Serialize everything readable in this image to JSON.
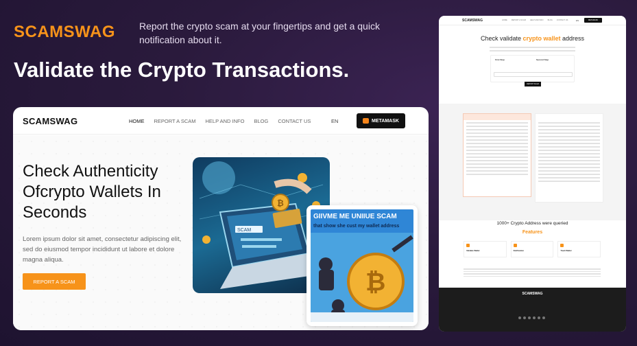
{
  "header": {
    "brand": "SCAMSWAG",
    "tagline": "Report the crypto scam at your fingertips and get a quick notification about it.",
    "headline": "Validate the Crypto Transactions."
  },
  "site": {
    "logo": "SCAMSWAG",
    "nav": [
      "HOME",
      "REPORT A SCAM",
      "HELP AND INFO",
      "BLOG",
      "CONTACT US"
    ],
    "language": "EN",
    "wallet_button": "METAMASK",
    "hero": {
      "title": "Check Authenticity Ofcrypto Wallets In Seconds",
      "body": "Lorem ipsum dolor sit amet, consectetur adipiscing elit, sed do eiusmod tempor incididunt ut labore et dolore magna aliqua.",
      "cta": "REPORT A SCAM"
    },
    "image_text": {
      "laptop_label": "SCAM",
      "poster_line1": "GIIVME ME UNIIUE SCAM",
      "poster_line2": "that show she cust my wallet address"
    }
  },
  "phone": {
    "title_prefix": "Check validate",
    "title_highlight": "crypto wallet",
    "title_suffix": "address",
    "step1": "First Step",
    "step2": "Second Step",
    "report_button": "REPORT SCAM",
    "count_text": "1000+ Crypto Address were queried",
    "features_title": "Features",
    "features": [
      "Validate Wallet",
      "Notification",
      "Track Wallet"
    ],
    "footer_logo": "SCAMSWAG"
  },
  "colors": {
    "accent": "#f7931a",
    "background": "#2a1a3c",
    "dark_button": "#111111"
  }
}
